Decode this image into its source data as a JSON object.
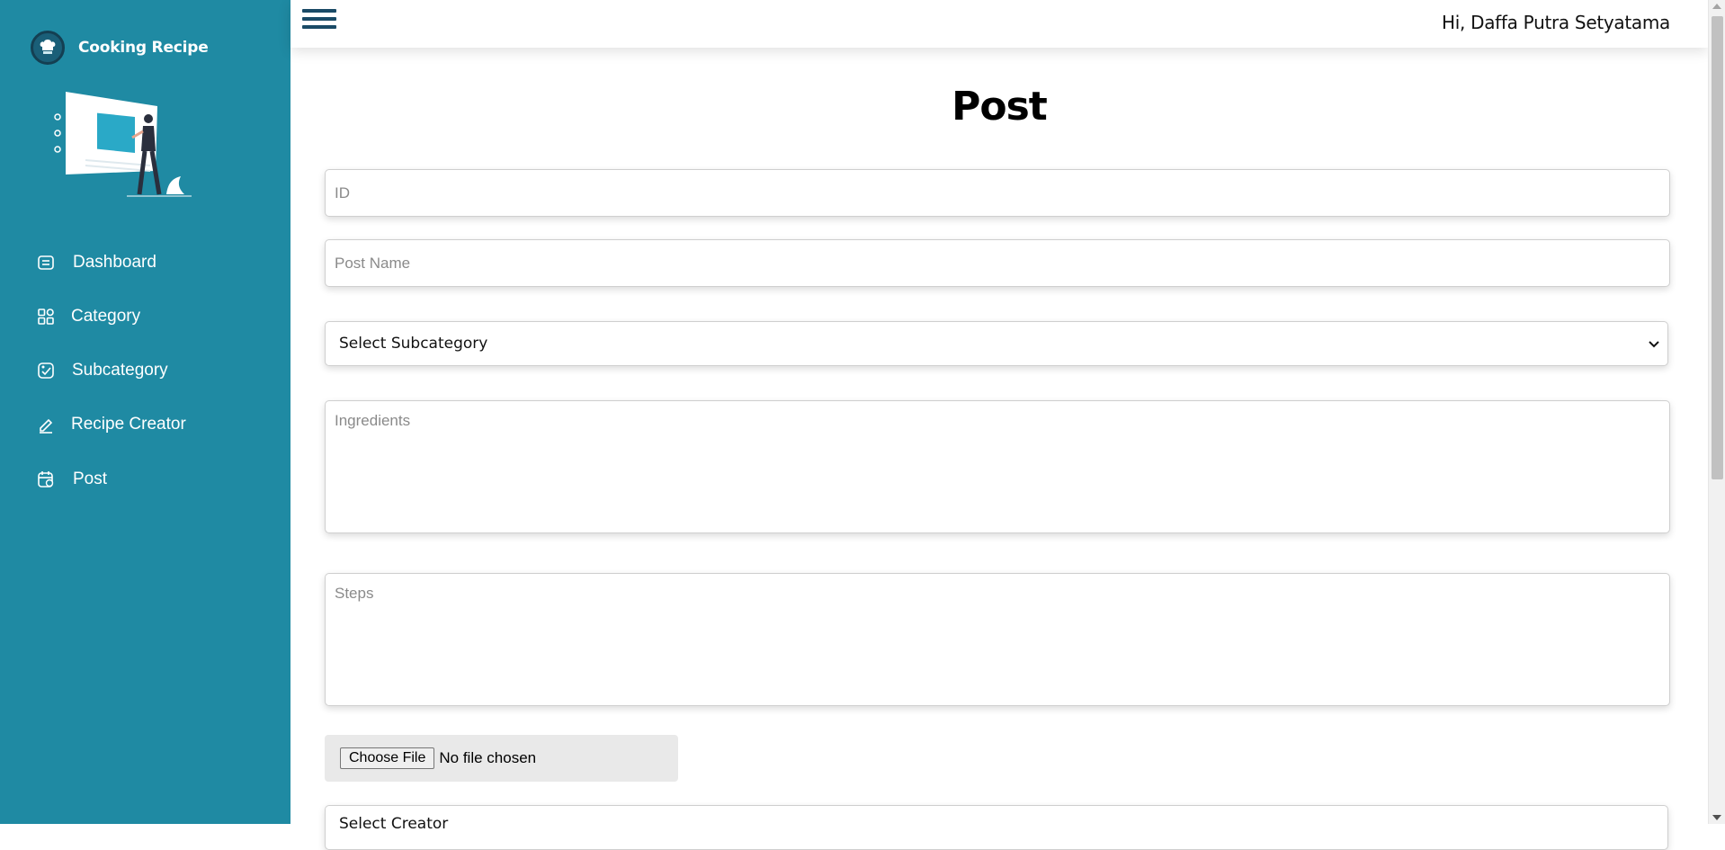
{
  "brand": {
    "name": "Cooking Recipe"
  },
  "sidebar": {
    "items": [
      {
        "label": "Dashboard",
        "icon": "dashboard-icon"
      },
      {
        "label": "Category",
        "icon": "grid-icon"
      },
      {
        "label": "Subcategory",
        "icon": "subcategory-icon"
      },
      {
        "label": "Recipe Creator",
        "icon": "pen-icon"
      },
      {
        "label": "Post",
        "icon": "calendar-icon"
      }
    ]
  },
  "header": {
    "greeting": "Hi, Daffa Putra Setyatama"
  },
  "main": {
    "title": "Post",
    "fields": {
      "id_placeholder": "ID",
      "post_name_placeholder": "Post Name",
      "subcategory_selected": "Select Subcategory",
      "ingredients_placeholder": "Ingredients",
      "steps_placeholder": "Steps",
      "file_button": "Choose File",
      "file_status": "No file chosen",
      "creator_selected": "Select Creator"
    }
  },
  "colors": {
    "sidebar": "#1f8aa3",
    "hamburger": "#1a4a66"
  }
}
